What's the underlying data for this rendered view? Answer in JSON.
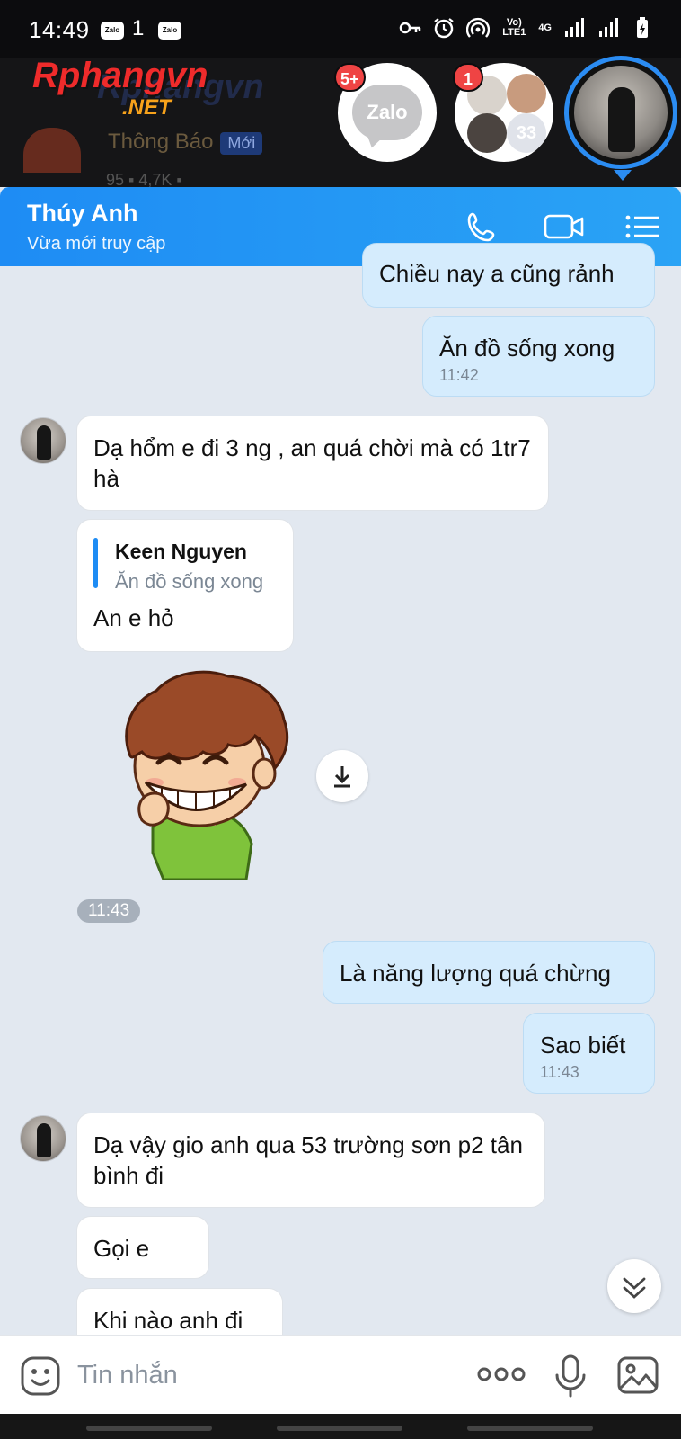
{
  "status_bar": {
    "time": "14:49",
    "notif_1": "Zalo",
    "notif_2": "1",
    "notif_3": "Zalo",
    "network": "Vo) LTE1",
    "network_4g": "4G"
  },
  "background_app": {
    "logo_main": "Rphangvn",
    "logo_sub": ".NET",
    "title": "Thông Báo",
    "title_badge": "Mới",
    "stats": "95 ▪  4,7K ▪"
  },
  "chat_heads": {
    "zalo_label": "Zalo",
    "zalo_badge": "5+",
    "group_badge": "1",
    "group_count": "33"
  },
  "header": {
    "name": "Thúy Anh",
    "status": "Vừa mới truy cập"
  },
  "messages": {
    "m0": {
      "text": "Chiều nay a cũng rảnh"
    },
    "m1": {
      "text": "Ăn đồ sống xong",
      "time": "11:42"
    },
    "m2": {
      "text": "Dạ hổm e đi 3 ng , an quá chời mà có 1tr7 hà"
    },
    "m3": {
      "quote_name": "Keen Nguyen",
      "quote_text": "Ăn đồ sống xong",
      "text": "An e hỏ"
    },
    "sticker_time": "11:43",
    "m5": {
      "text": "Là năng lượng quá chừng"
    },
    "m6": {
      "text": "Sao biết",
      "time": "11:43"
    },
    "m7": {
      "text": "Dạ vậy gio anh qua 53 trường sơn p2 tân bình đi"
    },
    "m8": {
      "text": "Gọi e"
    },
    "m9": {
      "text": "Khi nào anh đi"
    }
  },
  "input": {
    "placeholder": "Tin nhắn"
  },
  "colors": {
    "header_blue": "#1e8cf4",
    "my_bubble": "#d5ecfd",
    "other_bubble": "#ffffff",
    "badge_red": "#ef4444"
  }
}
